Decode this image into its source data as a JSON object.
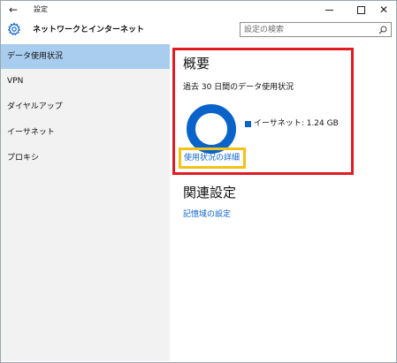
{
  "window": {
    "title": "設定",
    "back_icon": "arrow-left-icon",
    "controls": {
      "minimize": "minimize-icon",
      "maximize": "maximize-icon",
      "close_glyph": "✕"
    }
  },
  "header": {
    "icon": "gear-icon",
    "title": "ネットワークとインターネット",
    "search": {
      "placeholder": "設定の検索",
      "icon": "search-icon"
    }
  },
  "sidebar": {
    "items": [
      {
        "label": "データ使用状況",
        "active": true
      },
      {
        "label": "VPN",
        "active": false
      },
      {
        "label": "ダイヤルアップ",
        "active": false
      },
      {
        "label": "イーサネット",
        "active": false
      },
      {
        "label": "プロキシ",
        "active": false
      }
    ]
  },
  "main": {
    "overview_heading": "概要",
    "usage_period": "過去 30 日間のデータ使用状況",
    "legend": "イーサネット: 1.24 GB",
    "details_link": "使用状況の詳細",
    "related_heading": "関連設定",
    "storage_link": "記憶域の設定"
  },
  "colors": {
    "accent": "#0a63c9",
    "selected_nav": "#a9cdee",
    "sidebar_bg": "#f2f2f2",
    "annotation_red": "#e01b24",
    "annotation_yellow": "#f2c218"
  }
}
